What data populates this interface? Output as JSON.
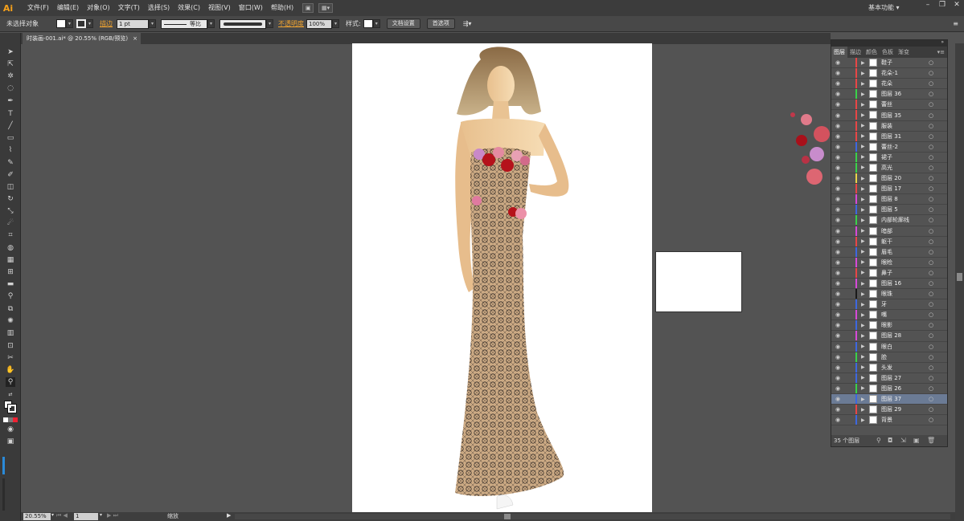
{
  "app": {
    "logo": "Ai"
  },
  "menu": [
    "文件(F)",
    "编辑(E)",
    "对象(O)",
    "文字(T)",
    "选择(S)",
    "效果(C)",
    "视图(V)",
    "窗口(W)",
    "帮助(H)"
  ],
  "workspace": "基本功能 ▾",
  "window_controls": [
    "–",
    "❐",
    "✕"
  ],
  "control_bar": {
    "selection": "未选择对象",
    "stroke_label": "描边",
    "stroke_value": "1 pt",
    "stroke_style": "等比",
    "opacity_label": "不透明度",
    "opacity_value": "100%",
    "style_label": "样式:",
    "doc_settings": "文档设置",
    "preferences": "首选项"
  },
  "document_tab": {
    "title": "时装画-001.ai* @ 20.55% (RGB/预览)",
    "close": "×"
  },
  "status": {
    "zoom": "20.55%",
    "page": "1",
    "tool": "缩放"
  },
  "panel": {
    "tabs": [
      "图层",
      "描边",
      "颜色",
      "色板",
      "渐变"
    ],
    "layer_count": "35 个图层",
    "layers": [
      {
        "name": "鞋子",
        "color": "#e84646"
      },
      {
        "name": "花朵-1",
        "color": "#e84646"
      },
      {
        "name": "花朵",
        "color": "#e84646"
      },
      {
        "name": "图层 36",
        "color": "#3ad24a"
      },
      {
        "name": "蕾丝",
        "color": "#e84646"
      },
      {
        "name": "图层 35",
        "color": "#e84646"
      },
      {
        "name": "服装",
        "color": "#e84646"
      },
      {
        "name": "图层 31",
        "color": "#e84646"
      },
      {
        "name": "蕾丝-2",
        "color": "#3d68e0"
      },
      {
        "name": "裙子",
        "color": "#3ad24a"
      },
      {
        "name": "高光",
        "color": "#3ad24a"
      },
      {
        "name": "图层 20",
        "color": "#e8d24a"
      },
      {
        "name": "图层 17",
        "color": "#e84646"
      },
      {
        "name": "图层 8",
        "color": "#d64ad8"
      },
      {
        "name": "图层 5",
        "color": "#3d68e0"
      },
      {
        "name": "内部轮廓线",
        "color": "#3ad24a"
      },
      {
        "name": "暗部",
        "color": "#d64ad8"
      },
      {
        "name": "躯干",
        "color": "#e84646"
      },
      {
        "name": "眉毛",
        "color": "#3d68e0"
      },
      {
        "name": "眼睑",
        "color": "#d64ad8"
      },
      {
        "name": "鼻子",
        "color": "#e84646"
      },
      {
        "name": "图层 16",
        "color": "#d64ad8"
      },
      {
        "name": "眼珠",
        "color": "#1a1a1a"
      },
      {
        "name": "牙",
        "color": "#3d68e0"
      },
      {
        "name": "嘴",
        "color": "#d64ad8"
      },
      {
        "name": "眼影",
        "color": "#3d68e0"
      },
      {
        "name": "图层 28",
        "color": "#d64ad8"
      },
      {
        "name": "眼白",
        "color": "#3d68e0"
      },
      {
        "name": "脸",
        "color": "#3ad24a"
      },
      {
        "name": "头发",
        "color": "#3d68e0"
      },
      {
        "name": "图层 27",
        "color": "#3d68e0"
      },
      {
        "name": "图层 26",
        "color": "#3ad24a"
      },
      {
        "name": "图层 37",
        "color": "#3d68e0",
        "selected": true
      },
      {
        "name": "图层 29",
        "color": "#e84646"
      },
      {
        "name": "背景",
        "color": "#3d68e0"
      }
    ]
  }
}
